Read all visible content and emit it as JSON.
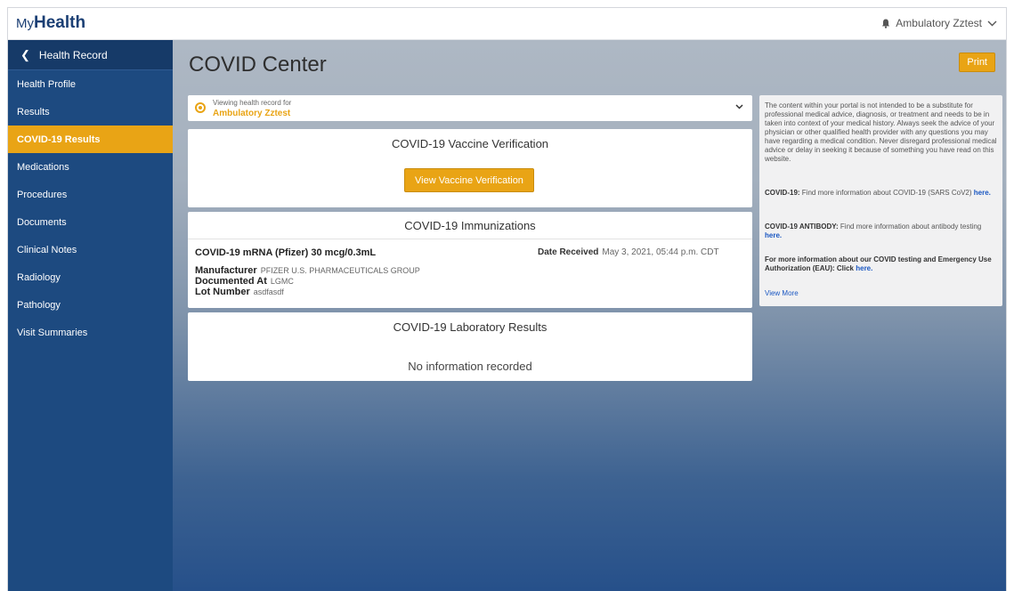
{
  "header": {
    "logo_my": "My",
    "logo_health": "Health",
    "user_name": "Ambulatory Zztest"
  },
  "sidebar": {
    "back_label": "Health Record",
    "items": [
      {
        "label": "Health Profile"
      },
      {
        "label": "Results"
      },
      {
        "label": "COVID-19 Results",
        "active": true
      },
      {
        "label": "Medications"
      },
      {
        "label": "Procedures"
      },
      {
        "label": "Documents"
      },
      {
        "label": "Clinical Notes"
      },
      {
        "label": "Radiology"
      },
      {
        "label": "Pathology"
      },
      {
        "label": "Visit Summaries"
      }
    ]
  },
  "main": {
    "title": "COVID Center",
    "print_label": "Print",
    "viewing": {
      "label": "Viewing health record for",
      "name": "Ambulatory Zztest"
    },
    "vaccine": {
      "title": "COVID-19 Vaccine Verification",
      "button_label": "View Vaccine Verification"
    },
    "immunizations": {
      "title": "COVID-19 Immunizations",
      "medication": "COVID-19 mRNA (Pfizer) 30 mcg/0.3mL",
      "date_label": "Date Received",
      "date_value": "May 3, 2021, 05:44 p.m. CDT",
      "manufacturer_label": "Manufacturer",
      "manufacturer_value": "PFIZER U.S. PHARMACEUTICALS GROUP",
      "documented_label": "Documented At",
      "documented_value": "LGMC",
      "lot_label": "Lot Number",
      "lot_value": "asdfasdf"
    },
    "lab": {
      "title": "COVID-19 Laboratory Results",
      "empty_text": "No information recorded"
    }
  },
  "info_panel": {
    "disclaimer": "The content within your portal is not intended to be a substitute for professional medical advice, diagnosis, or treatment and needs to be in taken into context of your medical history.  Always seek the advice of your physician or other qualified health provider with any questions you may have regarding a medical condition.  Never disregard professional medical advice or delay in seeking it because of something you have read on this website.",
    "covid_label": "COVID-19:",
    "covid_text": "Find more information about COVID-19 (SARS CoV2)",
    "antibody_label": "COVID-19 ANTIBODY:",
    "antibody_text": "Find more information about antibody testing",
    "eua_text": "For more information about our COVID testing and Emergency Use Authorization (EAU): Click",
    "here": "here.",
    "view_more": "View More"
  },
  "colors": {
    "accent": "#e9a415",
    "sidebar": "#1d4a80",
    "link": "#1a57c2"
  }
}
